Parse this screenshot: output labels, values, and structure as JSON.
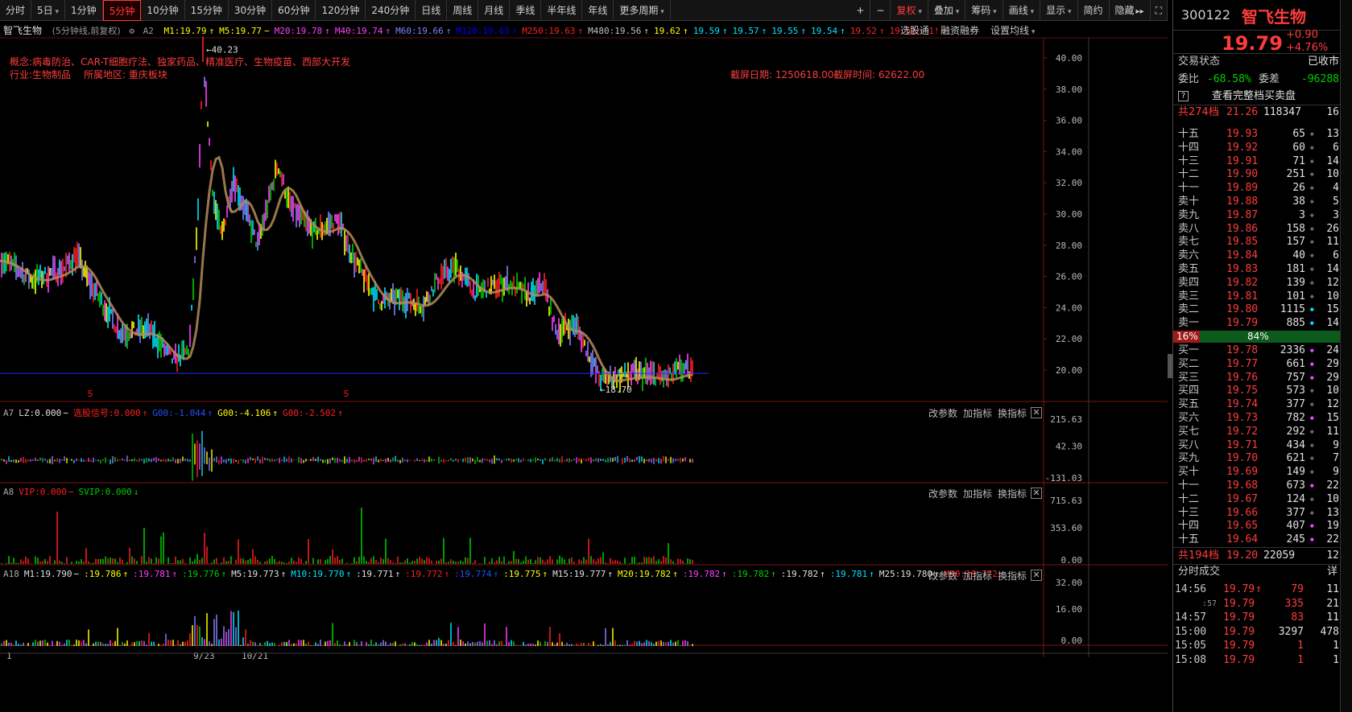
{
  "toolbar": {
    "periods": [
      "分时",
      "5日",
      "1分钟",
      "5分钟",
      "10分钟",
      "15分钟",
      "30分钟",
      "60分钟",
      "120分钟",
      "240分钟",
      "日线",
      "周线",
      "月线",
      "季线",
      "半年线",
      "年线",
      "更多周期"
    ],
    "active_period": "5分钟",
    "right_tools": [
      "+",
      "−",
      "复权",
      "叠加",
      "筹码",
      "画线",
      "显示",
      "简约",
      "隐藏"
    ]
  },
  "header": {
    "stock_name": "智飞生物",
    "chart_mode": "(5分钟线,前复权)",
    "mode_tag": "A2",
    "ma_legend": [
      {
        "label": "M1:19.79",
        "color": "#ffff00"
      },
      {
        "label": "M5:19.77",
        "color": "#ffff00"
      },
      {
        "label": "M20:19.78",
        "color": "#ff40ff"
      },
      {
        "label": "M40:19.74",
        "color": "#ff40ff"
      },
      {
        "label": "M60:19.66",
        "color": "#8080ff"
      },
      {
        "label": "M120:19.63",
        "color": "#0000ff"
      },
      {
        "label": "M250:19.63",
        "color": "#ff2020"
      },
      {
        "label": "M480:19.56",
        "color": "#c0c0c0"
      },
      {
        "label": "19.62",
        "color": "#ffff00"
      },
      {
        "label": "19.59",
        "color": "#00e5ff"
      },
      {
        "label": "19.57",
        "color": "#00e5ff"
      },
      {
        "label": "19.55",
        "color": "#00e5ff"
      },
      {
        "label": "19.54",
        "color": "#00e5ff"
      },
      {
        "label": "19.52",
        "color": "#ff2020"
      },
      {
        "label": "19.52",
        "color": "#ff2020"
      },
      {
        "label": "1!",
        "color": "#ff2020"
      }
    ],
    "right_links": [
      "选股通",
      "融资融券",
      "设置均线"
    ]
  },
  "annotations": {
    "concept": "概念:病毒防治、CAR-T细胞疗法、独家药品、精准医疗、生物疫苗、西部大开发",
    "industry": "行业:生物制品",
    "region": "所属地区: 重庆板块",
    "snap_date": "截屏日期: 1250618.00",
    "snap_time": "截屏时间: 62622.00",
    "high_marker": "40.23",
    "low_marker": "18.70",
    "s_marker": "S"
  },
  "main_chart": {
    "y_ticks": [
      "40.00",
      "38.00",
      "36.00",
      "34.00",
      "32.00",
      "30.00",
      "28.00",
      "26.00",
      "24.00",
      "22.00",
      "20.00"
    ],
    "x_ticks": [
      "1",
      "9/23",
      "10/21"
    ]
  },
  "panel_a7": {
    "tag": "A7",
    "legend": [
      {
        "label": "LZ:0.000",
        "color": "#e0e0e0"
      },
      {
        "label": "选股信号:0.000",
        "color": "#ff2020"
      },
      {
        "label": "G00:-1.044",
        "color": "#2050ff"
      },
      {
        "label": "G00:-4.106",
        "color": "#ffff00"
      },
      {
        "label": "G00:-2.502",
        "color": "#ff2020"
      }
    ],
    "y_ticks": [
      "215.63",
      "42.30",
      "-131.03"
    ]
  },
  "panel_a8": {
    "tag": "A8",
    "legend": [
      {
        "label": "VIP:0.000",
        "color": "#ff2020"
      },
      {
        "label": "SVIP:0.000",
        "color": "#00d000"
      }
    ],
    "y_ticks": [
      "715.63",
      "353.60",
      "0.00"
    ]
  },
  "panel_a18": {
    "tag": "A18",
    "legend": [
      {
        "label": "M1:19.790",
        "color": "#e0e0e0"
      },
      {
        "label": ":19.786",
        "color": "#ffff00"
      },
      {
        "label": ":19.781",
        "color": "#ff40ff"
      },
      {
        "label": ":19.776",
        "color": "#00d000"
      },
      {
        "label": "M5:19.773",
        "color": "#e0e0e0"
      },
      {
        "label": "M10:19.770",
        "color": "#00e5ff"
      },
      {
        "label": ":19.771",
        "color": "#e0e0e0"
      },
      {
        "label": ":19.772",
        "color": "#ff2020"
      },
      {
        "label": ":19.774",
        "color": "#2050ff"
      },
      {
        "label": ":19.775",
        "color": "#ffff00"
      },
      {
        "label": "M15:19.777",
        "color": "#e0e0e0"
      },
      {
        "label": "M20:19.782",
        "color": "#ffff00"
      },
      {
        "label": ":19.782",
        "color": "#ff40ff"
      },
      {
        "label": ":19.782",
        "color": "#00d000"
      },
      {
        "label": ":19.782",
        "color": "#e0e0e0"
      },
      {
        "label": ":19.781",
        "color": "#00e5ff"
      },
      {
        "label": "M25:19.780",
        "color": "#e0e0e0"
      },
      {
        "label": "M30:19.772",
        "color": "#ff2020"
      }
    ],
    "y_ticks": [
      "32.00",
      "16.00",
      "0.00"
    ]
  },
  "panel_buttons": [
    "改参数",
    "加指标",
    "换指标"
  ],
  "right_panel": {
    "code": "300122",
    "name": "智飞生物",
    "price": "19.79",
    "change": "+0.90",
    "change_pct": "+4.76%",
    "trade_status_label": "交易状态",
    "trade_status": "已收市",
    "weibi_label": "委比",
    "weibi": "-68.58%",
    "weicha_label": "委差",
    "weicha": "-96288",
    "full_book_btn": "查看完整档买卖盘",
    "ask_total": {
      "label": "共274档",
      "price": "21.26",
      "vol": "118347",
      "cnt": "16"
    },
    "asks": [
      {
        "lbl": "十五",
        "px": "19.93",
        "vol": "65",
        "dot": "",
        "cnt": "13"
      },
      {
        "lbl": "十四",
        "px": "19.92",
        "vol": "60",
        "dot": "",
        "cnt": "6"
      },
      {
        "lbl": "十三",
        "px": "19.91",
        "vol": "71",
        "dot": "",
        "cnt": "14"
      },
      {
        "lbl": "十二",
        "px": "19.90",
        "vol": "251",
        "dot": "",
        "cnt": "10"
      },
      {
        "lbl": "十一",
        "px": "19.89",
        "vol": "26",
        "dot": "",
        "cnt": "4"
      },
      {
        "lbl": "卖十",
        "px": "19.88",
        "vol": "38",
        "dot": "",
        "cnt": "5"
      },
      {
        "lbl": "卖九",
        "px": "19.87",
        "vol": "3",
        "dot": "",
        "cnt": "3"
      },
      {
        "lbl": "卖八",
        "px": "19.86",
        "vol": "158",
        "dot": "",
        "cnt": "26"
      },
      {
        "lbl": "卖七",
        "px": "19.85",
        "vol": "157",
        "dot": "",
        "cnt": "11"
      },
      {
        "lbl": "卖六",
        "px": "19.84",
        "vol": "40",
        "dot": "",
        "cnt": "6"
      },
      {
        "lbl": "卖五",
        "px": "19.83",
        "vol": "181",
        "dot": "",
        "cnt": "14"
      },
      {
        "lbl": "卖四",
        "px": "19.82",
        "vol": "139",
        "dot": "",
        "cnt": "12"
      },
      {
        "lbl": "卖三",
        "px": "19.81",
        "vol": "101",
        "dot": "",
        "cnt": "10"
      },
      {
        "lbl": "卖二",
        "px": "19.80",
        "vol": "1115",
        "dot": "cy",
        "cnt": "15"
      },
      {
        "lbl": "卖一",
        "px": "19.79",
        "vol": "885",
        "dot": "cy",
        "cnt": "14"
      }
    ],
    "ratio_bar": {
      "left": "16%",
      "right": "84%",
      "left_frac": 0.16
    },
    "bids": [
      {
        "lbl": "买一",
        "px": "19.78",
        "vol": "2336",
        "dot": "mg",
        "cnt": "24"
      },
      {
        "lbl": "买二",
        "px": "19.77",
        "vol": "661",
        "dot": "mg",
        "cnt": "29"
      },
      {
        "lbl": "买三",
        "px": "19.76",
        "vol": "757",
        "dot": "mg",
        "cnt": "29"
      },
      {
        "lbl": "买四",
        "px": "19.75",
        "vol": "573",
        "dot": "",
        "cnt": "10"
      },
      {
        "lbl": "买五",
        "px": "19.74",
        "vol": "377",
        "dot": "",
        "cnt": "12"
      },
      {
        "lbl": "买六",
        "px": "19.73",
        "vol": "782",
        "dot": "mg",
        "cnt": "15"
      },
      {
        "lbl": "买七",
        "px": "19.72",
        "vol": "292",
        "dot": "",
        "cnt": "11"
      },
      {
        "lbl": "买八",
        "px": "19.71",
        "vol": "434",
        "dot": "",
        "cnt": "9"
      },
      {
        "lbl": "买九",
        "px": "19.70",
        "vol": "621",
        "dot": "",
        "cnt": "7"
      },
      {
        "lbl": "买十",
        "px": "19.69",
        "vol": "149",
        "dot": "",
        "cnt": "9"
      },
      {
        "lbl": "十一",
        "px": "19.68",
        "vol": "673",
        "dot": "mg",
        "cnt": "22"
      },
      {
        "lbl": "十二",
        "px": "19.67",
        "vol": "124",
        "dot": "",
        "cnt": "10"
      },
      {
        "lbl": "十三",
        "px": "19.66",
        "vol": "377",
        "dot": "",
        "cnt": "13"
      },
      {
        "lbl": "十四",
        "px": "19.65",
        "vol": "407",
        "dot": "mg",
        "cnt": "19"
      },
      {
        "lbl": "十五",
        "px": "19.64",
        "vol": "245",
        "dot": "mg",
        "cnt": "22"
      }
    ],
    "bid_total": {
      "label": "共194档",
      "price": "19.20",
      "vol": "22059",
      "cnt": "12"
    },
    "ticks_title": "分时成交",
    "ticks_detail": "详",
    "ticks": [
      {
        "t": "14:56",
        "px": "19.79",
        "arrow": "↑",
        "vol": "79",
        "cnt": "11",
        "pxc": "#ff3c3c",
        "volc": "#ff3c3c"
      },
      {
        "t": ":57",
        "px": "19.79",
        "arrow": "",
        "vol": "335",
        "cnt": "21",
        "pxc": "#ff3c3c",
        "volc": "#ff3c3c"
      },
      {
        "t": "14:57",
        "px": "19.79",
        "arrow": "",
        "vol": "83",
        "cnt": "11",
        "pxc": "#ff3c3c",
        "volc": "#ff3c3c"
      },
      {
        "t": "15:00",
        "px": "19.79",
        "arrow": "",
        "vol": "3297",
        "cnt": "478",
        "pxc": "#ff3c3c",
        "volc": "#e0e0e0"
      },
      {
        "t": "15:05",
        "px": "19.79",
        "arrow": "",
        "vol": "1",
        "cnt": "1",
        "pxc": "#ff3c3c",
        "volc": "#ff3c3c"
      },
      {
        "t": "15:08",
        "px": "19.79",
        "arrow": "",
        "vol": "1",
        "cnt": "1",
        "pxc": "#ff3c3c",
        "volc": "#ff3c3c"
      }
    ]
  }
}
